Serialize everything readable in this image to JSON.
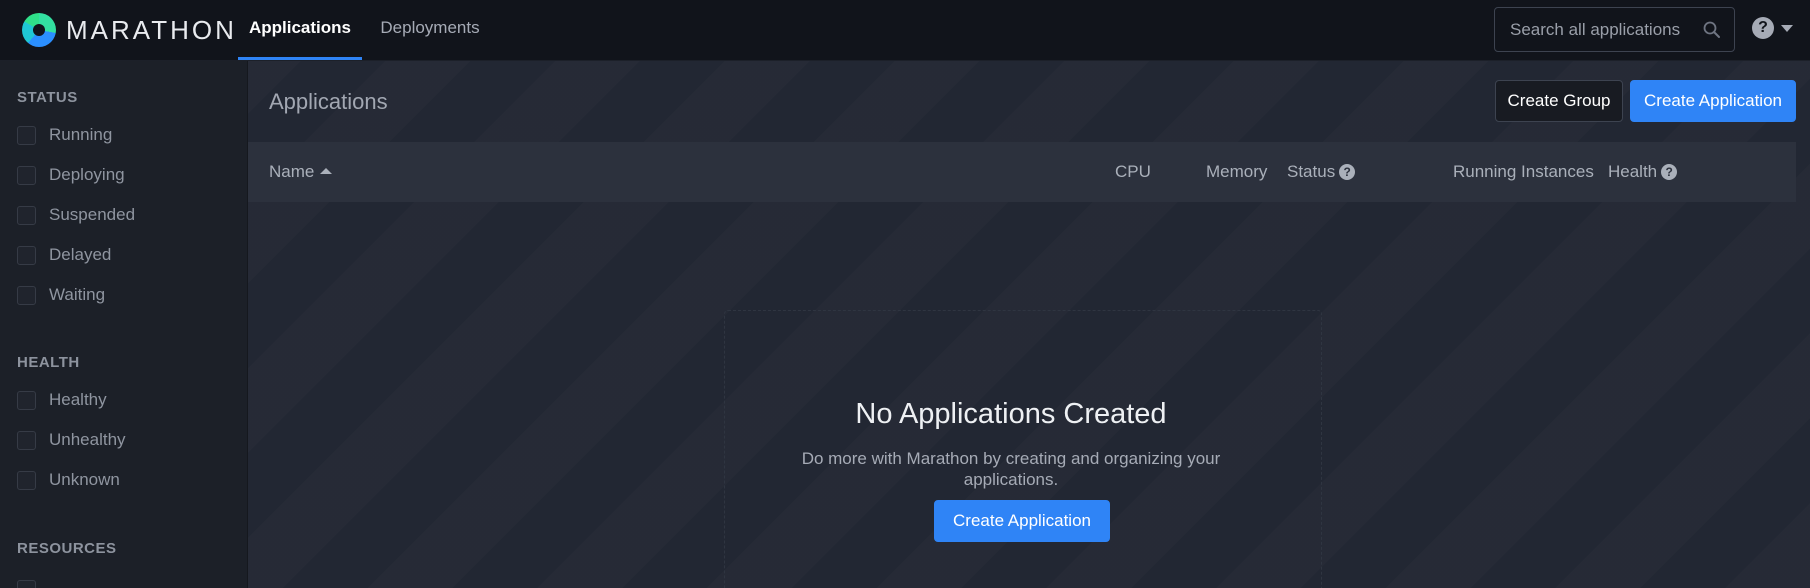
{
  "app": {
    "brand": "MARATHON",
    "colors": {
      "accent": "#2f84f6",
      "navbar_bg": "#11141b",
      "main_bg": "#232834",
      "sidebar_bg": "#1c2028"
    }
  },
  "nav": {
    "tabs": [
      {
        "label": "Applications",
        "active": true
      },
      {
        "label": "Deployments",
        "active": false
      }
    ],
    "search": {
      "placeholder": "Search all applications",
      "value": ""
    },
    "help_icon": "question-circle-icon"
  },
  "sidebar": {
    "sections": [
      {
        "heading": "STATUS",
        "items": [
          "Running",
          "Deploying",
          "Suspended",
          "Delayed",
          "Waiting"
        ]
      },
      {
        "heading": "HEALTH",
        "items": [
          "Healthy",
          "Unhealthy",
          "Unknown"
        ]
      },
      {
        "heading": "RESOURCES",
        "items": []
      }
    ]
  },
  "main": {
    "title": "Applications",
    "buttons": {
      "create_group": "Create Group",
      "create_application": "Create Application"
    },
    "table": {
      "columns": [
        "Name",
        "CPU",
        "Memory",
        "Status",
        "Running Instances",
        "Health"
      ],
      "sort_column": "Name",
      "sort_direction": "ascending"
    },
    "empty_state": {
      "title": "No Applications Created",
      "description": "Do more with Marathon by creating and organizing your applications.",
      "button": "Create Application"
    }
  }
}
